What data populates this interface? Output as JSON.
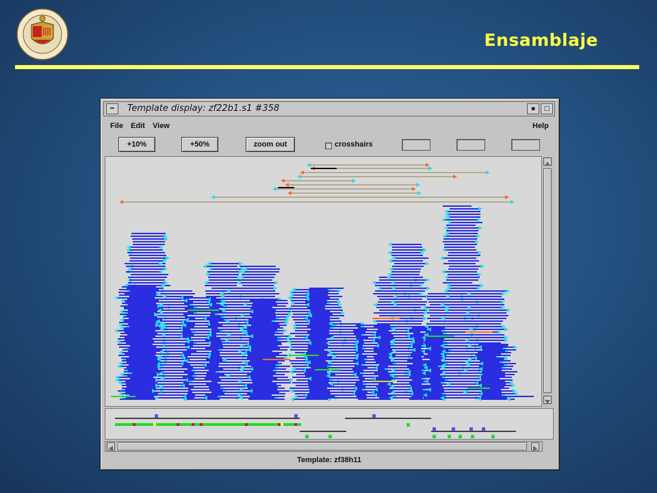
{
  "slide": {
    "title": "Ensamblaje",
    "logo_icon": "university-seal-icon",
    "accent_color": "#ffff44"
  },
  "window": {
    "title": "Template display: zf22b1.s1 #358",
    "menu_icon": "window-menu-icon",
    "minimize_icon": "minimize-icon",
    "maximize_icon": "maximize-icon",
    "menus": [
      "File",
      "Edit",
      "View"
    ],
    "help": "Help"
  },
  "toolbar": {
    "zoom10": "+10%",
    "zoom50": "+50%",
    "zoomout": "zoom out",
    "crosshairs": "crosshairs",
    "crosshairs_checked": false
  },
  "status": {
    "template": "Template: zf38h11"
  },
  "colors": {
    "read": "#2a2ee0",
    "end_marker": "#22ddee",
    "forward_arrow": "#ff6a33",
    "template_link": "#a89c7a",
    "highlight": "#22dd22",
    "panel_bg": "#d8d8d8"
  }
}
